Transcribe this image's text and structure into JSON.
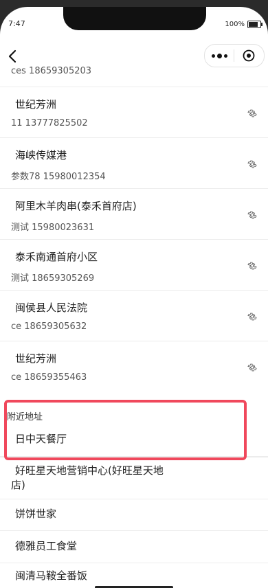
{
  "status": {
    "time": "7:47",
    "battery": "100%"
  },
  "saved_addresses": [
    {
      "name": "",
      "sub": "ces 18659305203"
    },
    {
      "name": "世纪芳洲",
      "sub": "11 13777825502"
    },
    {
      "name": "海峡传媒港",
      "sub": "参数78 15980012354"
    },
    {
      "name": "阿里木羊肉串(泰禾首府店)",
      "sub": "测试 15980023631"
    },
    {
      "name": "泰禾南通首府小区",
      "sub": "测试 18659305269"
    },
    {
      "name": "闽侯县人民法院",
      "sub": "ce 18659305632"
    },
    {
      "name": "世纪芳洲",
      "sub": "ce 18659355463"
    }
  ],
  "nearby": {
    "title": "附近地址",
    "items": [
      {
        "name": "日中天餐厅"
      },
      {
        "name": "好旺星天地营销中心(好旺星天地",
        "name2": "店)"
      },
      {
        "name": "饼饼世家"
      },
      {
        "name": "德雅员工食堂"
      },
      {
        "name": "闽清马鞍全番饭"
      }
    ]
  }
}
